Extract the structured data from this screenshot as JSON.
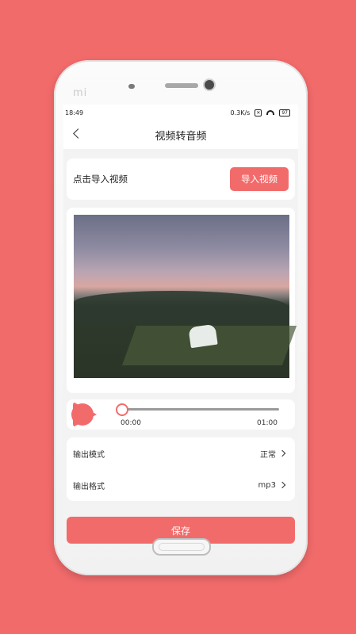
{
  "device": {
    "brand": "mi"
  },
  "status": {
    "time": "18:49",
    "speed": "0.3K/s",
    "battery": "97",
    "sim": "✕"
  },
  "nav": {
    "title": "视频转音频"
  },
  "import": {
    "label": "点击导入视频",
    "button": "导入视频"
  },
  "player": {
    "current": "00:00",
    "duration": "01:00",
    "progress": 0.0
  },
  "settings": {
    "output_mode": {
      "label": "输出模式",
      "value": "正常"
    },
    "output_format": {
      "label": "输出格式",
      "value": "mp3"
    }
  },
  "actions": {
    "save": "保存"
  },
  "colors": {
    "accent": "#f26b6b"
  }
}
